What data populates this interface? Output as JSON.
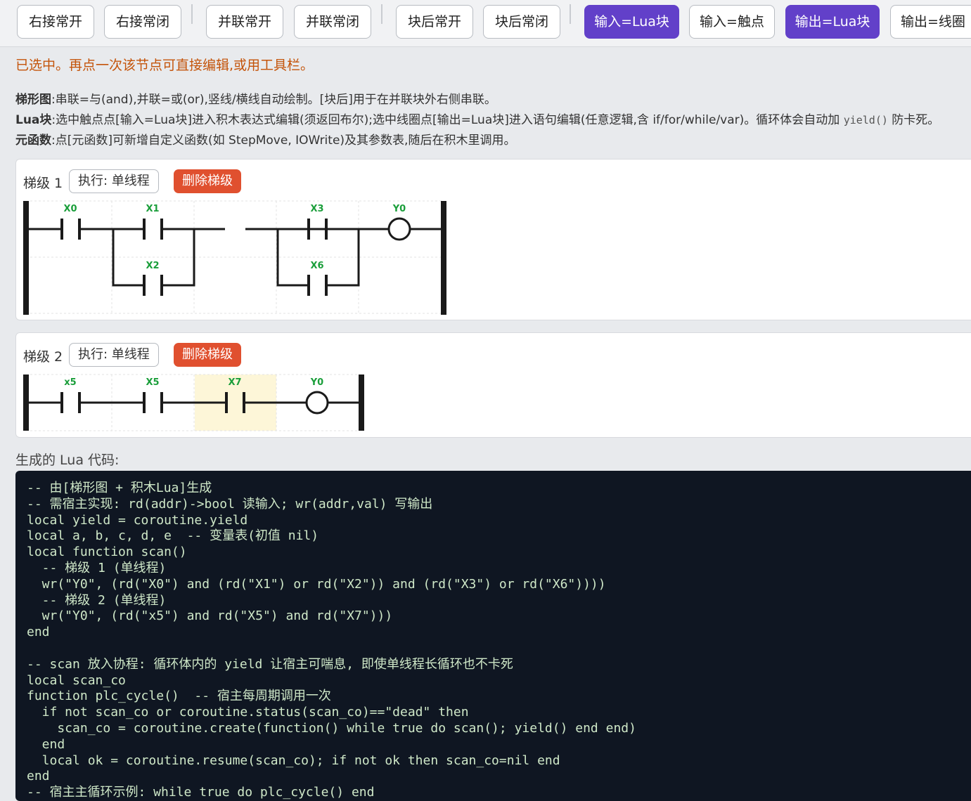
{
  "toolbar": {
    "buttons": [
      {
        "label": "右接常开"
      },
      {
        "label": "右接常闭"
      },
      {
        "label": "并联常开"
      },
      {
        "label": "并联常闭"
      },
      {
        "label": "块后常开"
      },
      {
        "label": "块后常闭"
      },
      {
        "label": "输入=Lua块"
      },
      {
        "label": "输入=触点"
      },
      {
        "label": "输出=Lua块"
      },
      {
        "label": "输出=线圈"
      }
    ]
  },
  "status_message": "已选中。再点一次该节点可直接编辑,或用工具栏。",
  "help": {
    "ladder_label": "梯形图",
    "ladder_text": ":串联=与(and),并联=或(or),竖线/横线自动绘制。[块后]用于在并联块外右侧串联。",
    "lua_label": "Lua块",
    "lua_text": ":选中触点点[输入=Lua块]进入积木表达式编辑(须返回布尔);选中线圈点[输出=Lua块]进入语句编辑(任意逻辑,含 if/for/while/var)。循环体会自动加 ",
    "lua_code": "yield()",
    "lua_text_end": " 防卡死。",
    "meta_label": "元函数",
    "meta_text": ":点[元函数]可新增自定义函数(如 StepMove, IOWrite)及其参数表,随后在积木里调用。"
  },
  "rungs": [
    {
      "title": "梯级 1",
      "exec_label": "执行: 单线程",
      "delete_label": "删除梯级",
      "contacts": [
        {
          "label": "X0"
        },
        {
          "label": "X1"
        },
        {
          "label": "X2"
        },
        {
          "label": "X3"
        },
        {
          "label": "X6"
        }
      ],
      "coil": {
        "label": "Y0"
      }
    },
    {
      "title": "梯级 2",
      "exec_label": "执行: 单线程",
      "delete_label": "删除梯级",
      "contacts": [
        {
          "label": "x5"
        },
        {
          "label": "X5"
        },
        {
          "label": "X7",
          "selected": true
        }
      ],
      "coil": {
        "label": "Y0"
      }
    }
  ],
  "code_label": "生成的 Lua 代码:",
  "code": "-- 由[梯形图 + 积木Lua]生成\n-- 需宿主实现: rd(addr)->bool 读输入; wr(addr,val) 写输出\nlocal yield = coroutine.yield\nlocal a, b, c, d, e  -- 变量表(初值 nil)\nlocal function scan()\n  -- 梯级 1 (单线程)\n  wr(\"Y0\", (rd(\"X0\") and (rd(\"X1\") or rd(\"X2\")) and (rd(\"X3\") or rd(\"X6\"))))\n  -- 梯级 2 (单线程)\n  wr(\"Y0\", (rd(\"x5\") and rd(\"X5\") and rd(\"X7\")))\nend\n\n-- scan 放入协程: 循环体内的 yield 让宿主可喘息, 即使单线程长循环也不卡死\nlocal scan_co\nfunction plc_cycle()  -- 宿主每周期调用一次\n  if not scan_co or coroutine.status(scan_co)==\"dead\" then\n    scan_co = coroutine.create(function() while true do scan(); yield() end end)\n  end\n  local ok = coroutine.resume(scan_co); if not ok then scan_co=nil end\nend\n-- 宿主主循环示例: while true do plc_cycle() end",
  "colors": {
    "accent": "#6240c9",
    "danger": "#e0502f",
    "message": "#c4540a",
    "label_green": "#1a9e3a",
    "selected_cell": "#fdf6d8",
    "code_bg": "#0f1622"
  }
}
